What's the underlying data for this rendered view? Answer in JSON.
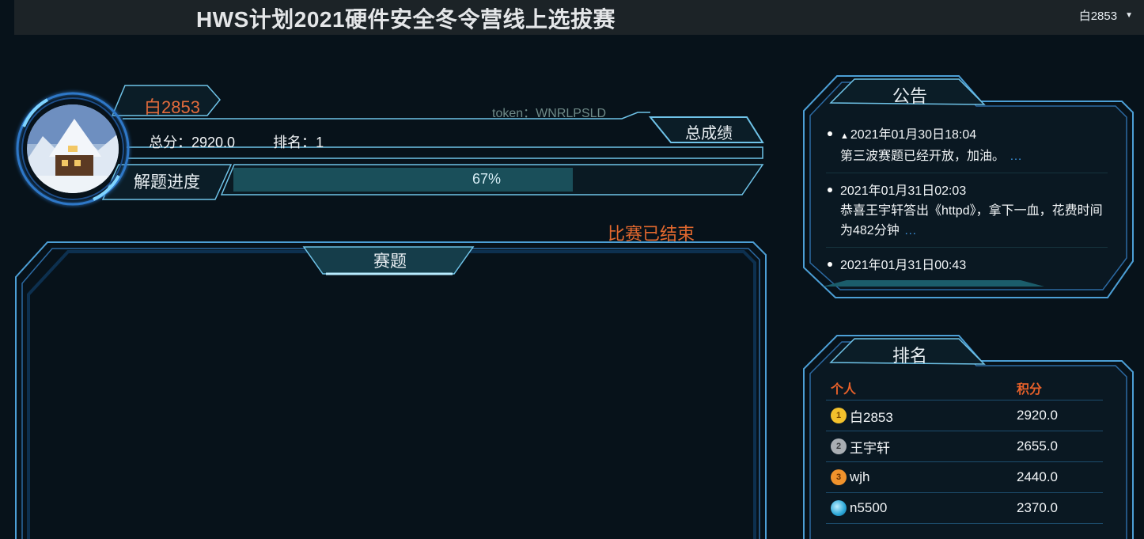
{
  "header": {
    "title": "HWS计划2021硬件安全冬令营线上选拔赛",
    "user_menu_label": "白2853"
  },
  "profile": {
    "username": "白2853",
    "token_label": "token：",
    "token_value": "WNRLPSLD",
    "total_label": "总成绩",
    "score_label": "总分：",
    "score_value": "2920.0",
    "rank_label": "排名：",
    "rank_value": "1",
    "progress_label": "解题进度",
    "progress_text": "67%",
    "progress_fraction": 0.67
  },
  "status": {
    "ended": "比赛已结束"
  },
  "challenges": {
    "title": "赛题"
  },
  "notices": {
    "title": "公告",
    "items": [
      {
        "time": "2021年01月30日18:04",
        "text": "第三波赛题已经开放，加油。",
        "more": "…",
        "pinned": true
      },
      {
        "time": "2021年01月31日02:03",
        "text": "恭喜王宇轩答出《httpd》，拿下一血，花费时间为482分钟",
        "more": "…",
        "pinned": false
      },
      {
        "time": "2021年01月31日00:43",
        "text": "",
        "more": "",
        "pinned": false
      }
    ]
  },
  "ranking": {
    "title": "排名",
    "col_person": "个人",
    "col_score": "积分",
    "rows": [
      {
        "badge": "1",
        "name": "白2853",
        "score": "2920.0",
        "badge_color": "#f3c12c"
      },
      {
        "badge": "2",
        "name": "王宇轩",
        "score": "2655.0",
        "badge_color": "#a9aeb3"
      },
      {
        "badge": "3",
        "name": "wjh",
        "score": "2440.0",
        "badge_color": "#f0922c"
      },
      {
        "badge": "",
        "name": "n5500",
        "score": "2370.0",
        "badge_color": "#2aa7d8"
      }
    ]
  },
  "colors": {
    "accent_orange": "#e26b3c",
    "frame_cyan": "#4fb3e8",
    "background": "#07121a"
  }
}
